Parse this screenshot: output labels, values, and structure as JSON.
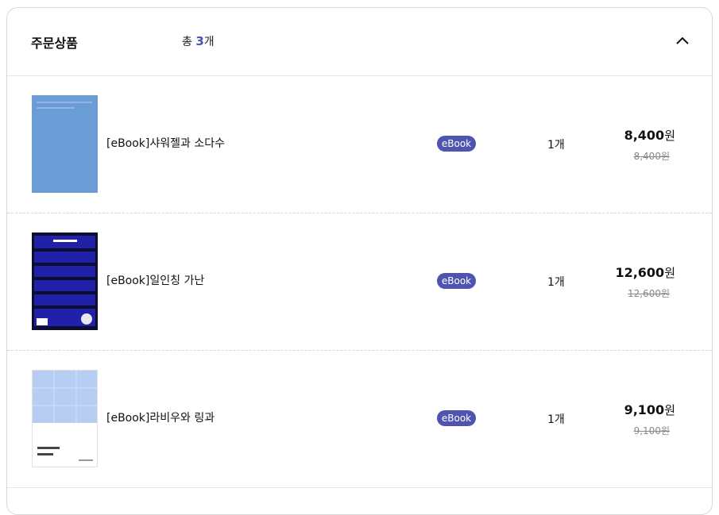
{
  "section": {
    "title": "주문상품",
    "count_prefix": "총",
    "count_value": "3",
    "count_suffix": "개"
  },
  "icons": {
    "toggle": "chevron-up-icon"
  },
  "colors": {
    "badge": "#4e54b0",
    "count_accent": "#4a4fb0"
  },
  "items": [
    {
      "name": "[eBook]샤워젤과 소다수",
      "badge": "eBook",
      "quantity": "1개",
      "price": "8,400",
      "price_unit": "원",
      "original_price": "8,400원",
      "cover_color": "#6a9dd6"
    },
    {
      "name": "[eBook]일인칭 가난",
      "badge": "eBook",
      "quantity": "1개",
      "price": "12,600",
      "price_unit": "원",
      "original_price": "12,600원",
      "cover_color": "#1a1d9a"
    },
    {
      "name": "[eBook]라비우와 링과",
      "badge": "eBook",
      "quantity": "1개",
      "price": "9,100",
      "price_unit": "원",
      "original_price": "9,100원",
      "cover_color": "#b8cdf2"
    }
  ]
}
